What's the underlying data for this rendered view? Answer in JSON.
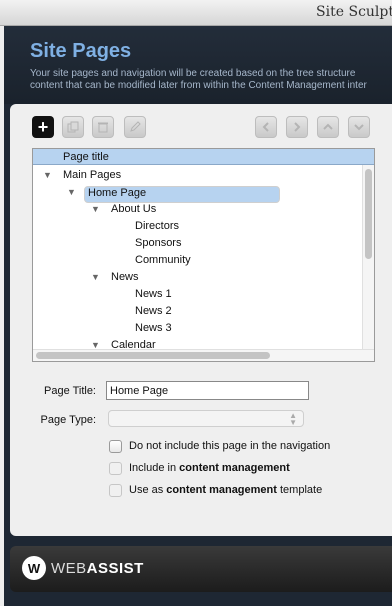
{
  "window": {
    "title": "Site Sculpt"
  },
  "header": {
    "title": "Site Pages",
    "description_line1": "Your site pages and navigation will be created based on the tree structure",
    "description_line2": "content that can be modified later from within the Content Management inter"
  },
  "toolbar": {
    "add_symbol": "+",
    "copy_icon": "copy-icon",
    "delete_icon": "trash-icon",
    "edit_icon": "edit-icon",
    "nav_icons": [
      "arrow-left-icon",
      "arrow-right-icon",
      "arrow-up-icon",
      "arrow-down-icon"
    ]
  },
  "tree": {
    "column_header": "Page title",
    "rows": [
      {
        "label": "Main Pages",
        "expanded": true,
        "selected": false
      },
      {
        "label": "Home Page",
        "expanded": true,
        "selected": true
      },
      {
        "label": "About Us",
        "expanded": true,
        "selected": false
      },
      {
        "label": "Directors",
        "expanded": false,
        "selected": false
      },
      {
        "label": "Sponsors",
        "expanded": false,
        "selected": false
      },
      {
        "label": "Community",
        "expanded": false,
        "selected": false
      },
      {
        "label": "News",
        "expanded": true,
        "selected": false
      },
      {
        "label": "News 1",
        "expanded": false,
        "selected": false
      },
      {
        "label": "News 2",
        "expanded": false,
        "selected": false
      },
      {
        "label": "News 3",
        "expanded": false,
        "selected": false
      },
      {
        "label": "Calendar",
        "expanded": true,
        "selected": false
      }
    ]
  },
  "form": {
    "page_title_label": "Page Title:",
    "page_title_value": "Home Page",
    "page_type_label": "Page Type:",
    "page_type_value": ""
  },
  "options": {
    "exclude_nav": "Do not include this page in the navigation",
    "include_prefix": "Include in ",
    "include_bold": "content management",
    "template_prefix": "Use as ",
    "template_bold": "content management",
    "template_suffix": " template"
  },
  "footer": {
    "logo_mark": "W",
    "brand_light": "WEB",
    "brand_bold": "ASSIST"
  }
}
